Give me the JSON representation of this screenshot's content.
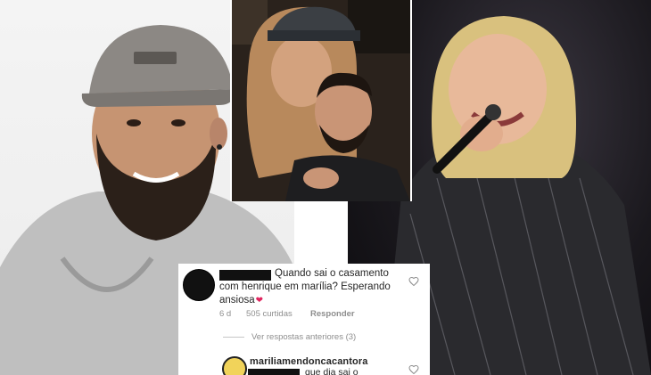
{
  "comment": {
    "text_line1": "Quando sai o casamento",
    "text_line2": "com henrique em marília? Esperando",
    "text_line3": "ansiosa",
    "age": "6 d",
    "likes": "505 curtidas",
    "reply": "Responder"
  },
  "view_replies": "Ver respostas anteriores (3)",
  "reply_comment": {
    "username": "mariliamendoncacantora",
    "text_fragment": "que dia sai o"
  },
  "colors": {
    "heart_emoji": "#e0245e",
    "muted_text": "#8e8e8e"
  },
  "icons": [
    "heart-icon",
    "avatar",
    "verified-avatar"
  ]
}
